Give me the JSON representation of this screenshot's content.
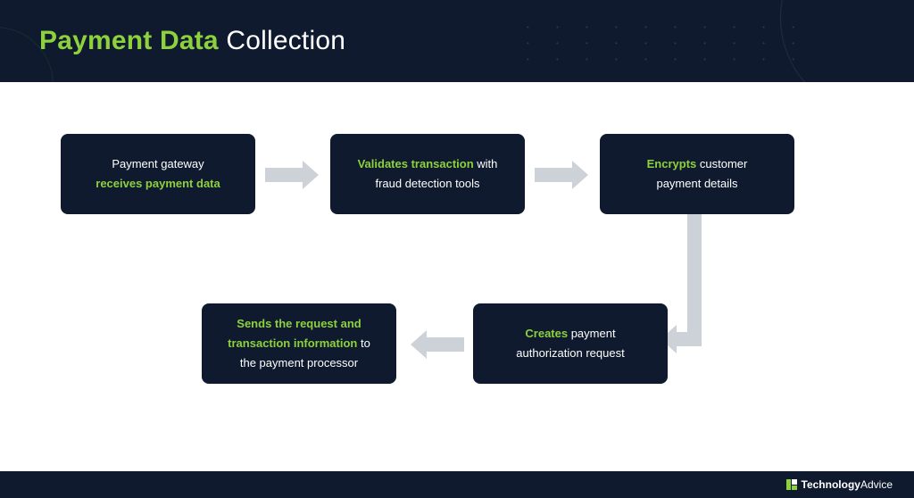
{
  "header": {
    "title_accent": "Payment Data",
    "title_rest": " Collection"
  },
  "nodes": {
    "n1": {
      "line1_plain": "Payment gateway",
      "line2_accent": "receives payment data"
    },
    "n2": {
      "accent": "Validates transaction",
      "rest": " with",
      "line2": "fraud detection tools"
    },
    "n3": {
      "accent": "Encrypts",
      "rest": " customer",
      "line2": "payment details"
    },
    "n4": {
      "accent": "Creates",
      "rest": " payment",
      "line2": "authorization request"
    },
    "n5": {
      "line1_accent": "Sends the request and",
      "line2_accent": "transaction information",
      "line2_rest": " to",
      "line3": "the payment processor"
    }
  },
  "footer": {
    "brand_bold": "Technology",
    "brand_light": "Advice"
  },
  "flow_order": [
    "n1",
    "n2",
    "n3",
    "n4",
    "n5"
  ],
  "colors": {
    "card_bg": "#0f1a2e",
    "accent_green": "#8dd13d",
    "arrow_grey": "#cdd2d8",
    "text_white": "#ffffff"
  }
}
